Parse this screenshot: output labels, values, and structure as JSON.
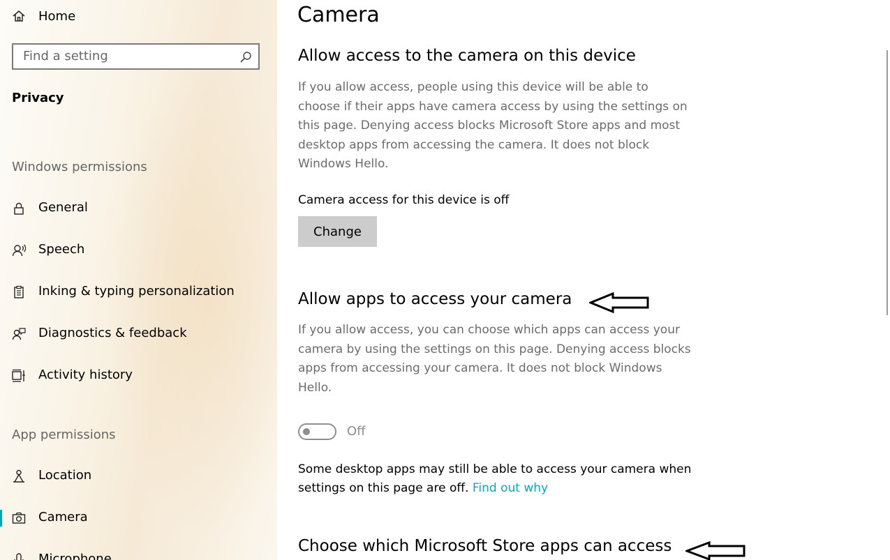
{
  "sidebar": {
    "home": "Home",
    "search": {
      "placeholder": "Find a setting"
    },
    "section": "Privacy",
    "windows_permissions": {
      "label": "Windows permissions",
      "items": [
        {
          "label": "General",
          "icon": "lock-icon"
        },
        {
          "label": "Speech",
          "icon": "speech-icon"
        },
        {
          "label": "Inking & typing personalization",
          "icon": "clipboard-icon"
        },
        {
          "label": "Diagnostics & feedback",
          "icon": "feedback-icon"
        },
        {
          "label": "Activity history",
          "icon": "timeline-icon"
        }
      ]
    },
    "app_permissions": {
      "label": "App permissions",
      "items": [
        {
          "label": "Location",
          "icon": "location-icon"
        },
        {
          "label": "Camera",
          "icon": "camera-icon",
          "selected": true
        },
        {
          "label": "Microphone",
          "icon": "microphone-icon"
        }
      ]
    },
    "accent_color": "#0aa7b2"
  },
  "main": {
    "title": "Camera",
    "device_section": {
      "heading": "Allow access to the camera on this device",
      "description": "If you allow access, people using this device will be able to choose if their apps have camera access by using the settings on this page. Denying access blocks Microsoft Store apps and most desktop apps from accessing the camera. It does not block Windows Hello.",
      "status": "Camera access for this device is off",
      "button": "Change"
    },
    "apps_section": {
      "heading": "Allow apps to access your camera",
      "description": "If you allow access, you can choose which apps can access your camera by using the settings on this page. Denying access blocks apps from accessing your camera. It does not block Windows Hello.",
      "toggle_state": "Off",
      "note": "Some desktop apps may still be able to access your camera when settings on this page are off.",
      "link": "Find out why"
    },
    "store_section": {
      "heading": "Choose which Microsoft Store apps can access"
    }
  }
}
